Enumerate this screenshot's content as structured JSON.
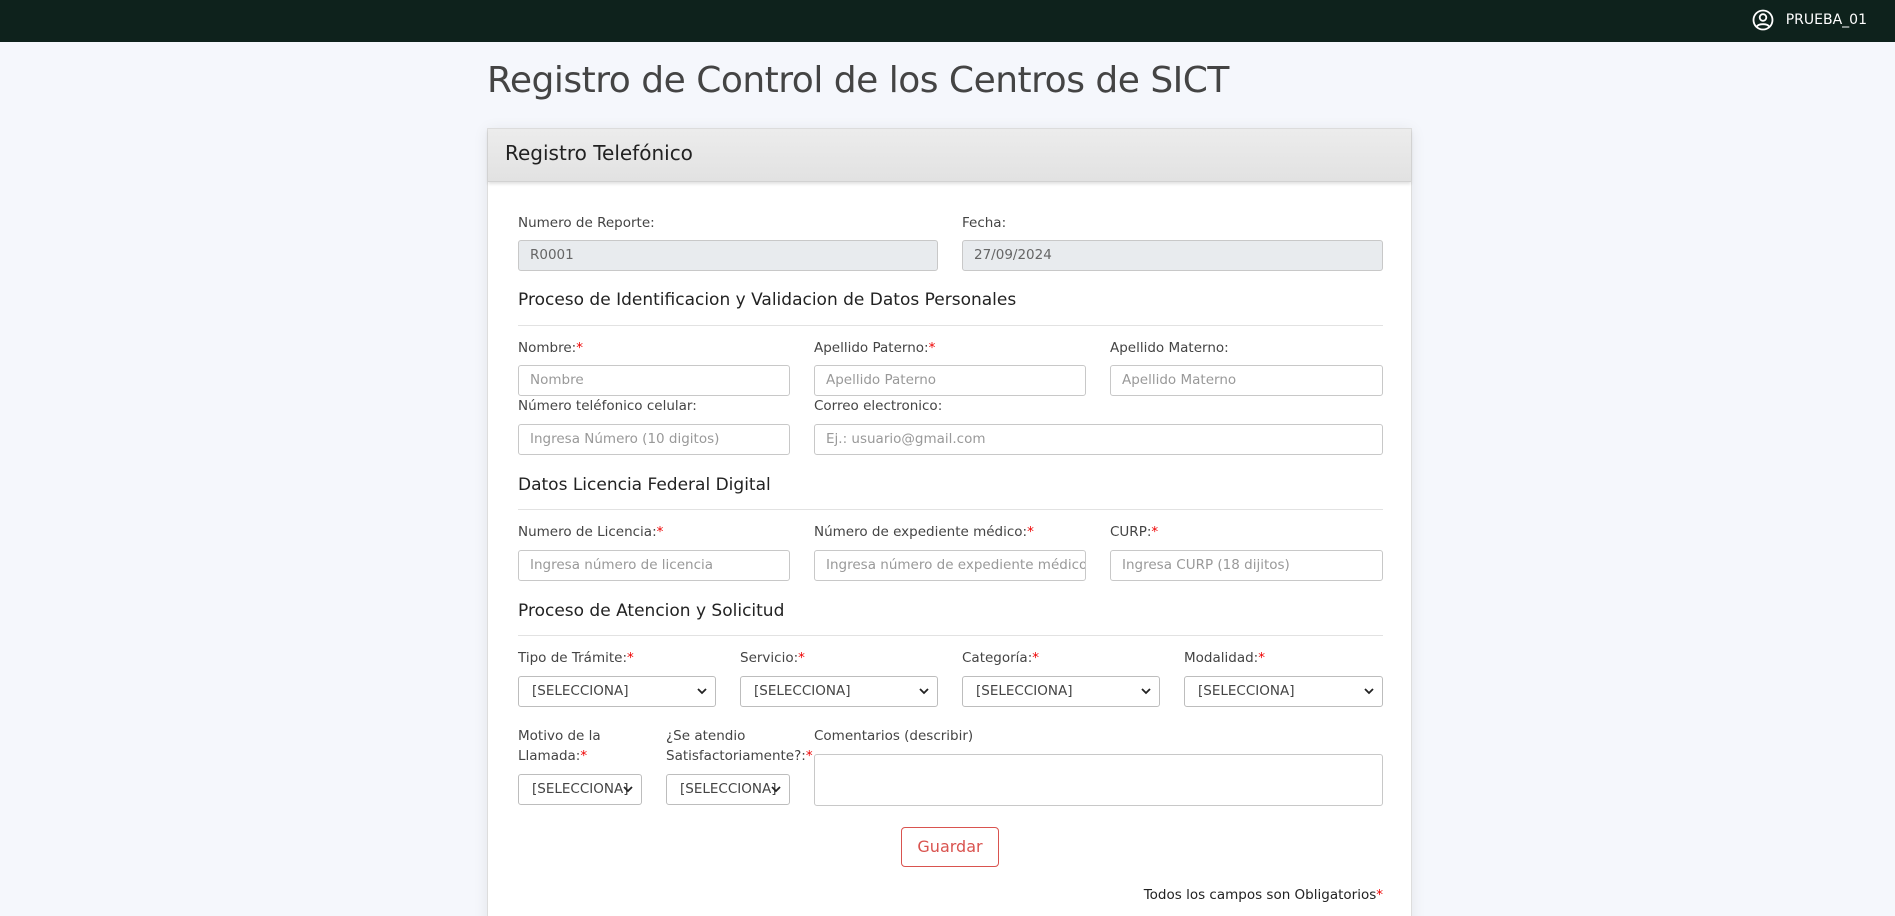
{
  "topbar": {
    "user_name": "PRUEBA_01",
    "user_icon": "user-circle-icon"
  },
  "page_title": "Registro de Control de los Centros de SICT",
  "card": {
    "header": "Registro Telefónico",
    "report_label": "Numero de Reporte:",
    "report_value": "R0001",
    "date_label": "Fecha:",
    "date_value": "27/09/2024",
    "section_personal": "Proceso de Identificacion y Validacion de Datos Personales",
    "nombre_label": "Nombre:",
    "nombre_placeholder": "Nombre",
    "paterno_label": "Apellido Paterno:",
    "paterno_placeholder": "Apellido Paterno",
    "materno_label": "Apellido Materno:",
    "materno_placeholder": "Apellido Materno",
    "telefono_label": "Número teléfonico celular:",
    "telefono_placeholder": "Ingresa Número (10 digitos)",
    "correo_label": "Correo electronico:",
    "correo_placeholder": "Ej.: usuario@gmail.com",
    "section_licencia": "Datos Licencia Federal Digital",
    "licencia_label": "Numero de Licencia:",
    "licencia_placeholder": "Ingresa número de licencia",
    "expediente_label": "Número de expediente médico:",
    "expediente_placeholder": "Ingresa número de expediente médico",
    "curp_label": "CURP:",
    "curp_placeholder": "Ingresa CURP (18 dijitos)",
    "section_atencion": "Proceso de Atencion y Solicitud",
    "tramite_label": "Tipo de Trámite:",
    "servicio_label": "Servicio:",
    "categoria_label": "Categoría:",
    "modalidad_label": "Modalidad:",
    "select_default": "[SELECCIONA]",
    "motivo_label_1": "Motivo de la",
    "motivo_label_2": "Llamada:",
    "satisf_label_1": "¿Se atendio",
    "satisf_label_2": "Satisfactoriamente?:",
    "comentarios_label": "Comentarios (describir)",
    "save_button": "Guardar",
    "required_note": "Todos los campos son Obligatorios",
    "required_mark": "*"
  },
  "colors": {
    "topbar": "#0e221c",
    "required": "#ee0000",
    "button": "#d9534f"
  }
}
